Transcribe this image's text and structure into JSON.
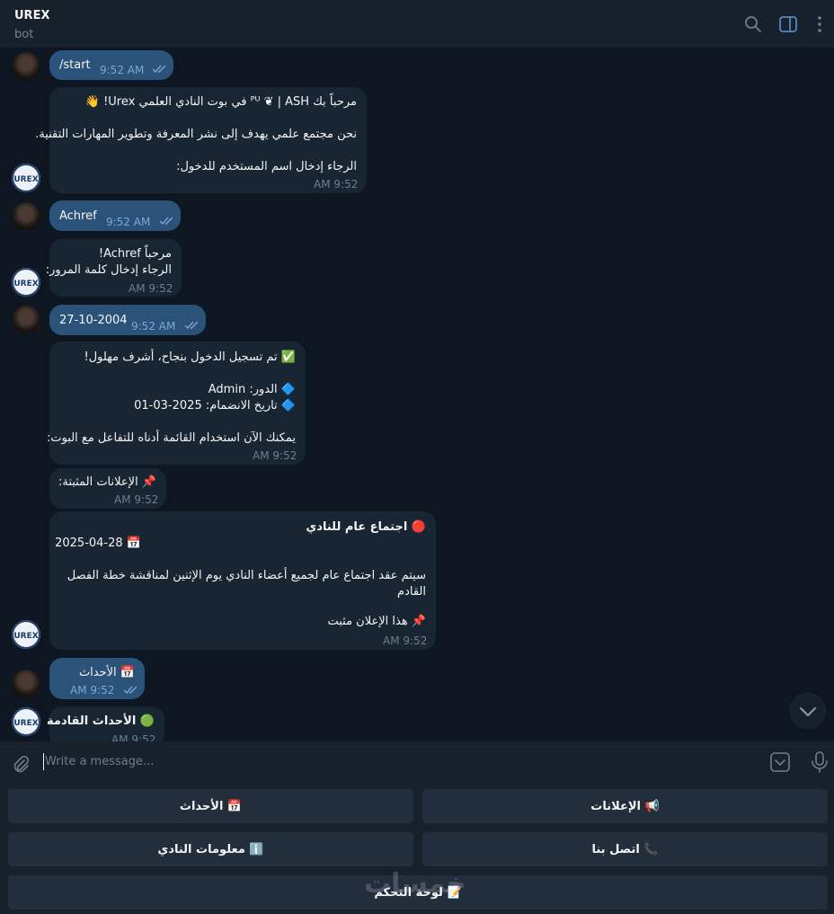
{
  "header": {
    "title": "UREX",
    "subtitle": "bot"
  },
  "messages": [
    {
      "id": "m1",
      "dir": "out",
      "text": "/start",
      "time": "9:52 AM"
    },
    {
      "id": "m2",
      "dir": "in",
      "lines": [
        "مرحباً بك ᴾᵁ ❦ | ASH في بوت النادي العلمي Urex! 👋",
        "",
        "نحن مجتمع علمي يهدف إلى نشر المعرفة وتطوير المهارات التقنية.",
        "",
        "الرجاء إدخال اسم المستخدم للدخول:"
      ],
      "time": "9:52 AM"
    },
    {
      "id": "m3",
      "dir": "out",
      "text": "Achref",
      "time": "9:52 AM"
    },
    {
      "id": "m4",
      "dir": "in",
      "lines": [
        "مرحباً Achref!",
        "الرجاء إدخال كلمة المرور:"
      ],
      "time": "9:52 AM"
    },
    {
      "id": "m5",
      "dir": "out",
      "text": "27-10-2004",
      "time": "9:52 AM"
    },
    {
      "id": "m6",
      "dir": "in",
      "lines": [
        "✅ تم تسجيل الدخول بنجاح، أشرف مهلول!",
        "",
        "🔷 الدور: Admin",
        "🔷 تاريخ الانضمام: 2025-03-01",
        "",
        "يمكنك الآن استخدام القائمة أدناه للتفاعل مع البوت:"
      ],
      "time": "9:52 AM"
    },
    {
      "id": "m7",
      "dir": "in",
      "lines": [
        "📌 الإعلانات المثبتة:"
      ],
      "time": "9:52 AM"
    },
    {
      "id": "m8",
      "dir": "in",
      "lines": [
        "🔴 اجتماع عام للنادي",
        "📅 2025-04-28",
        "",
        "سيتم عقد اجتماع عام لجميع أعضاء النادي يوم الإثنين لمناقشة خطة الفصل",
        "القادم",
        "",
        "📌 هذا الإعلان مثبت"
      ],
      "time": "9:52 AM"
    },
    {
      "id": "m9",
      "dir": "out",
      "text": "📅 الأحداث",
      "time": "9:52 AM"
    },
    {
      "id": "m10",
      "dir": "in",
      "lines": [
        "🟢 الأحداث القادمة"
      ],
      "time": "9:52 AM"
    }
  ],
  "composer": {
    "placeholder": "Write a message..."
  },
  "keyboard": {
    "events": "📅 الأحداث",
    "announcements": "📢 الإعلانات",
    "club_info": "ℹ️ معلومات النادي",
    "contact": "📞 اتصل بنا",
    "dashboard": "📝 لوحة التحكم"
  },
  "watermark": "خمسات",
  "colors": {
    "background": "#0e1621",
    "panel": "#17212b",
    "bubble_out": "#2b5278",
    "bubble_in": "#182533",
    "button": "#232e3c",
    "accent": "#5288c1"
  }
}
